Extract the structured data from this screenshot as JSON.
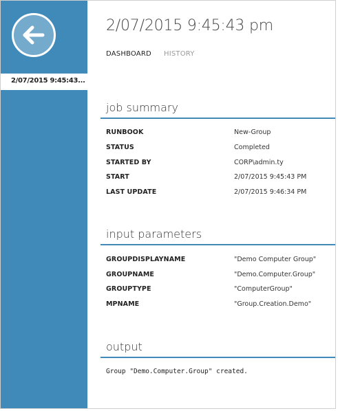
{
  "sidebar": {
    "back_icon": "back-arrow-icon",
    "items": [
      {
        "label": "2/07/2015 9:45:43..."
      }
    ]
  },
  "header": {
    "title": "2/07/2015 9:45:43 pm"
  },
  "tabs": [
    {
      "label": "DASHBOARD",
      "active": true
    },
    {
      "label": "HISTORY",
      "active": false
    }
  ],
  "job_summary": {
    "title": "job summary",
    "rows": [
      {
        "key": "RUNBOOK",
        "value": "New-Group"
      },
      {
        "key": "STATUS",
        "value": "Completed"
      },
      {
        "key": "STARTED BY",
        "value": "CORP\\admin.ty"
      },
      {
        "key": "START",
        "value": "2/07/2015 9:45:43 PM"
      },
      {
        "key": "LAST UPDATE",
        "value": "2/07/2015 9:46:34 PM"
      }
    ]
  },
  "input_parameters": {
    "title": "input parameters",
    "rows": [
      {
        "key": "GROUPDISPLAYNAME",
        "value": "\"Demo Computer Group\""
      },
      {
        "key": "GROUPNAME",
        "value": "\"Demo.Computer.Group\""
      },
      {
        "key": "GROUPTYPE",
        "value": "\"ComputerGroup\""
      },
      {
        "key": "MPNAME",
        "value": "\"Group.Creation.Demo\""
      }
    ]
  },
  "output": {
    "title": "output",
    "text": "Group \"Demo.Computer.Group\" created."
  },
  "colors": {
    "accent": "#3f8ab9",
    "sidebar_item_bg": "#ffffff"
  }
}
